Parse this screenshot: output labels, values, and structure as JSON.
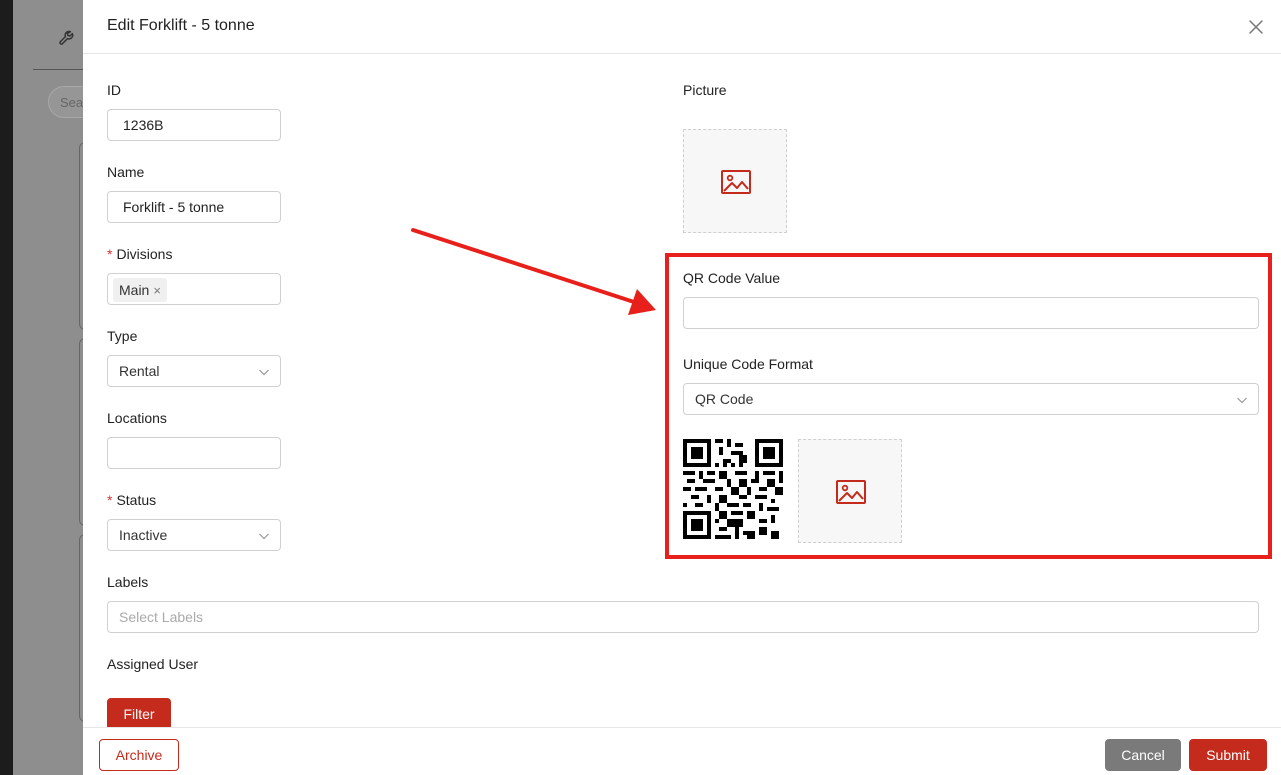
{
  "background": {
    "search_placeholder": "Sea"
  },
  "modal": {
    "title": "Edit Forklift - 5 tonne",
    "close_icon": "close-icon"
  },
  "form": {
    "id": {
      "label": "ID",
      "value": "1236B"
    },
    "name": {
      "label": "Name",
      "value": "Forklift - 5 tonne"
    },
    "divisions": {
      "required_mark": "*",
      "label": "Divisions",
      "tags": [
        "Main"
      ],
      "tag_remove_glyph": "×"
    },
    "type": {
      "label": "Type",
      "value": "Rental"
    },
    "locations": {
      "label": "Locations",
      "value": ""
    },
    "status": {
      "required_mark": "*",
      "label": "Status",
      "value": "Inactive"
    },
    "labels": {
      "label": "Labels",
      "placeholder": "Select Labels"
    },
    "assigned_user": {
      "label": "Assigned User",
      "filter_label": "Filter"
    },
    "picture": {
      "label": "Picture",
      "icon": "image-icon"
    },
    "qr_code_value": {
      "label": "QR Code Value",
      "value": ""
    },
    "unique_code_format": {
      "label": "Unique Code Format",
      "value": "QR Code"
    }
  },
  "footer": {
    "archive_label": "Archive",
    "cancel_label": "Cancel",
    "submit_label": "Submit"
  },
  "colors": {
    "accent": "#c42b1c",
    "annotation": "#e8201b",
    "cancel": "#7a7a7a"
  }
}
